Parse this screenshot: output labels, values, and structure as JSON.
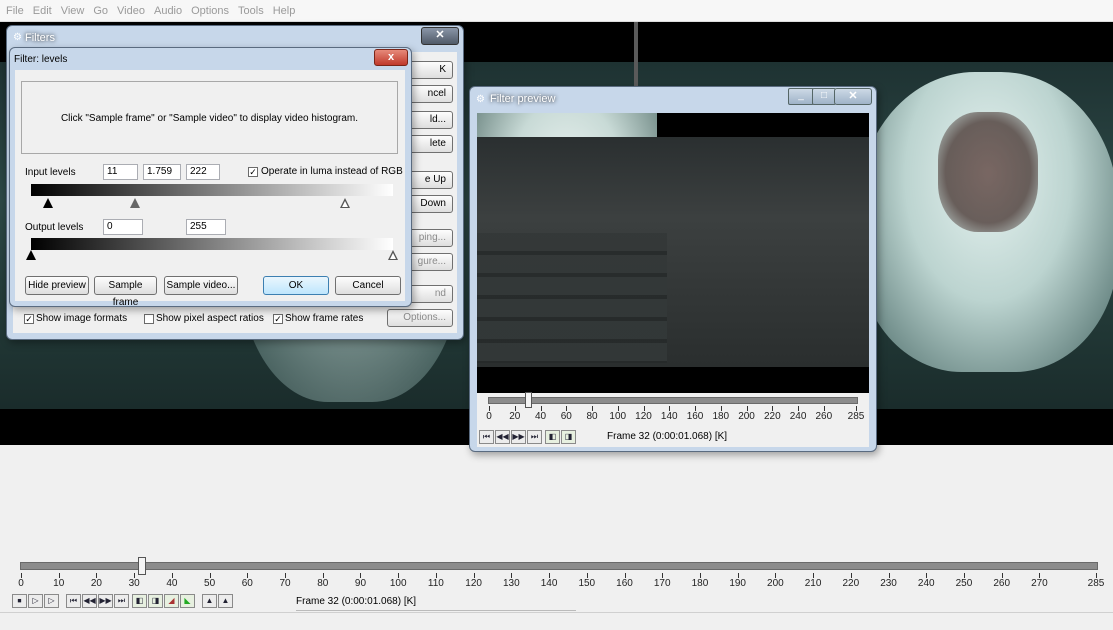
{
  "menu": [
    "File",
    "Edit",
    "View",
    "Go",
    "Video",
    "Audio",
    "Options",
    "Tools",
    "Help"
  ],
  "filters_window": {
    "title": "Filters",
    "right_buttons": [
      "OK",
      "Cancel",
      "Add...",
      "Delete",
      "Move Up",
      "Move Down",
      "Cropping...",
      "Configure...",
      "Blend",
      "Options..."
    ],
    "right_buttons_visible": [
      "K",
      "ncel",
      "ld...",
      "lete",
      "e Up",
      "Down",
      "ping...",
      "gure...",
      "nd",
      "Options..."
    ],
    "checkboxes": [
      {
        "label": "Show image formats",
        "checked": true
      },
      {
        "label": "Show pixel aspect ratios",
        "checked": false
      },
      {
        "label": "Show frame rates",
        "checked": true
      }
    ]
  },
  "levels_dialog": {
    "title": "Filter: levels",
    "close_label": "x",
    "histogram_message": "Click \"Sample frame\" or \"Sample video\" to display video histogram.",
    "input_levels_label": "Input levels",
    "input_low": "11",
    "input_gamma": "1.759",
    "input_high": "222",
    "operate_luma_label": "Operate in luma instead of RGB",
    "operate_luma_checked": true,
    "output_levels_label": "Output levels",
    "output_low": "0",
    "output_high": "255",
    "buttons": {
      "hide_preview": "Hide preview",
      "sample_frame": "Sample frame",
      "sample_video": "Sample video...",
      "ok": "OK",
      "cancel": "Cancel"
    }
  },
  "preview_window": {
    "title": "Filter preview",
    "timeline_labels": [
      "0",
      "20",
      "40",
      "60",
      "80",
      "100",
      "120",
      "140",
      "160",
      "180",
      "200",
      "220",
      "240",
      "260",
      "285"
    ],
    "current_frame": 32,
    "frame_text": "Frame 32 (0:00:01.068) [K]"
  },
  "main_timeline": {
    "labels": [
      "0",
      "10",
      "20",
      "30",
      "40",
      "50",
      "60",
      "70",
      "80",
      "90",
      "100",
      "110",
      "120",
      "130",
      "140",
      "150",
      "160",
      "170",
      "180",
      "190",
      "200",
      "210",
      "220",
      "230",
      "240",
      "250",
      "260",
      "270",
      "285"
    ],
    "current_frame": 32,
    "total_frames": 285,
    "frame_text": "Frame 32 (0:00:01.068) [K]"
  }
}
